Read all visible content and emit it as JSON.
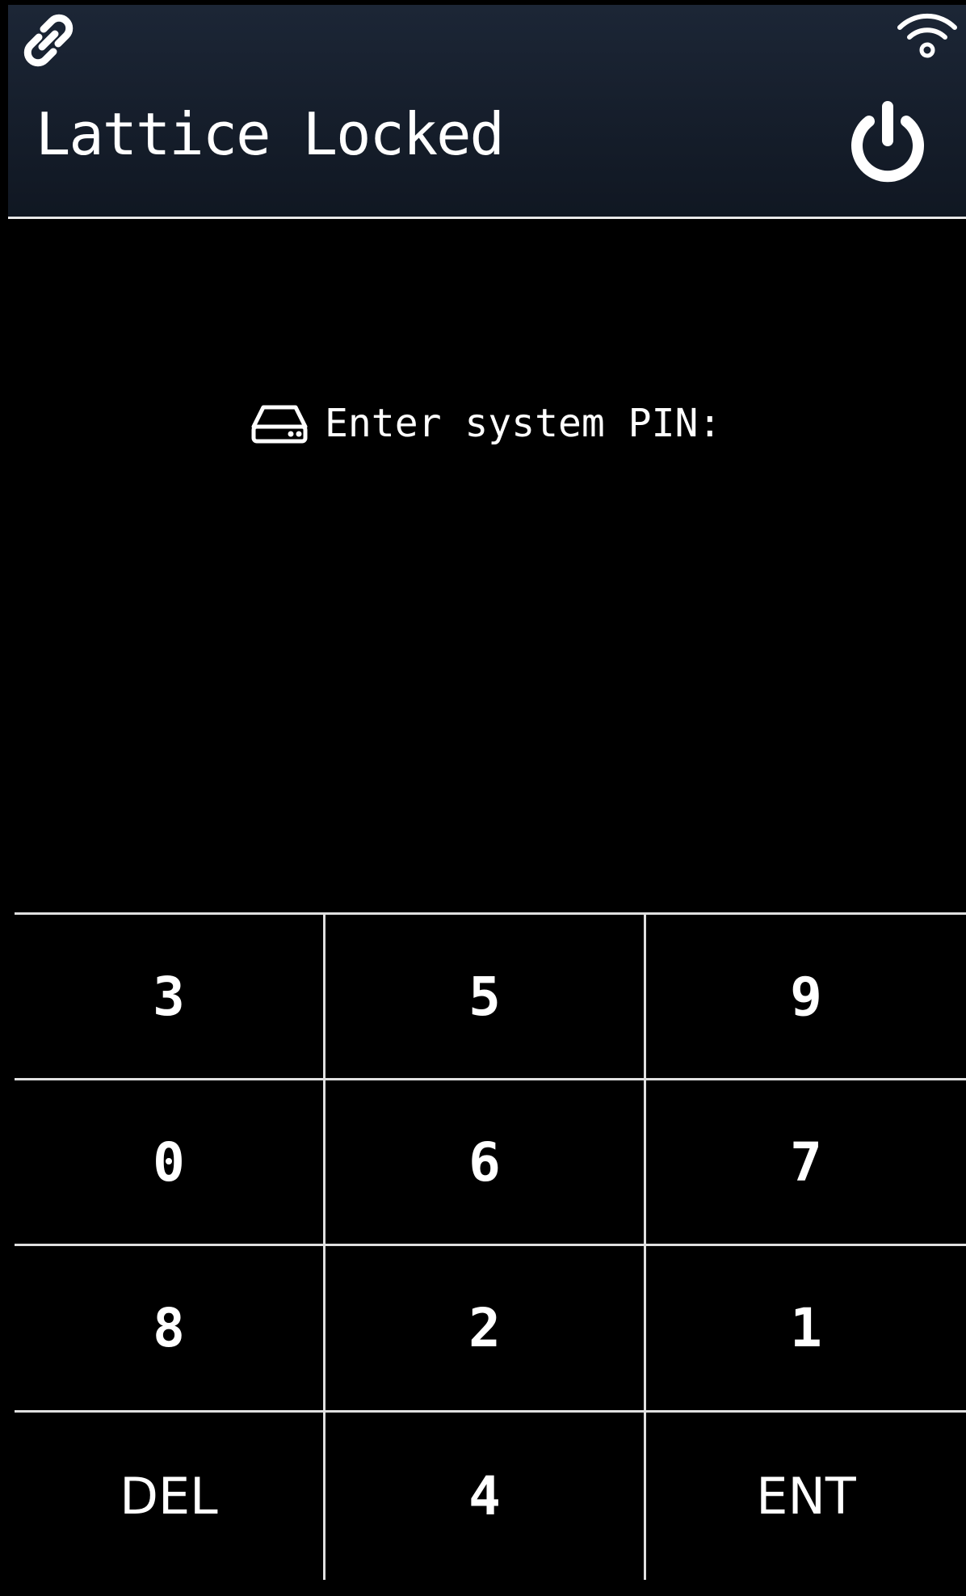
{
  "header": {
    "title": "Lattice Locked",
    "link_icon": "link-icon",
    "wifi_icon": "wifi-icon",
    "power_icon": "power-icon"
  },
  "prompt": {
    "icon": "hard-drive-icon",
    "text": "Enter system PIN:"
  },
  "keypad": {
    "keys": [
      "3",
      "5",
      "9",
      "0",
      "6",
      "7",
      "8",
      "2",
      "1",
      "DEL",
      "4",
      "ENT"
    ]
  },
  "colors": {
    "background": "#000000",
    "header_background": "#1c2636",
    "foreground": "#ffffff",
    "grid_lines": "#e0e0e0"
  }
}
